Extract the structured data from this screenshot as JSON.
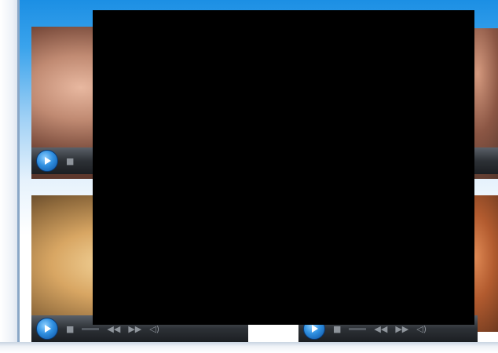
{
  "players": [
    {
      "id": "top-left",
      "controls": {
        "stop": "■",
        "prev": "◀◀",
        "next": "▶▶",
        "volume": "◁)"
      }
    },
    {
      "id": "top-right",
      "controls": {}
    },
    {
      "id": "bottom-left",
      "controls": {
        "stop": "■",
        "prev": "◀◀",
        "next": "▶▶",
        "volume": "◁)"
      }
    },
    {
      "id": "bottom-right",
      "controls": {
        "stop": "■",
        "prev": "◀◀",
        "next": "▶▶",
        "volume": "◁)"
      }
    }
  ],
  "colors": {
    "panel_top": "#1c8fe4",
    "overlay": "#000000",
    "control_bar": "#2d3136",
    "play_button": "#2f8fe0"
  }
}
